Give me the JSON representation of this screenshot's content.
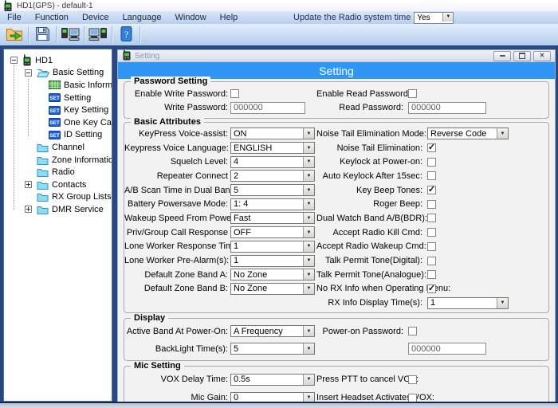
{
  "window": {
    "title": "HD1(GPS)  -  default-1",
    "menu": [
      "File",
      "Function",
      "Device",
      "Language",
      "Window",
      "Help"
    ],
    "update_time_label": "Update the Radio system time",
    "update_time_value": "Yes",
    "toolbar": [
      {
        "name": "open-file-icon"
      },
      {
        "name": "save-file-icon"
      },
      {
        "name": "read-from-radio-icon"
      },
      {
        "name": "write-to-radio-icon"
      },
      {
        "name": "help-icon"
      }
    ]
  },
  "tree": {
    "items": [
      {
        "label": "HD1",
        "icon": "radio",
        "expander": "minus",
        "level": 0
      },
      {
        "label": "Basic Setting",
        "icon": "folder-open",
        "expander": "minus",
        "level": 1
      },
      {
        "label": "Basic Information",
        "icon": "table",
        "level": 2
      },
      {
        "label": "Setting",
        "icon": "set",
        "level": 2
      },
      {
        "label": "Key Setting",
        "icon": "set",
        "level": 2
      },
      {
        "label": "One Key Call",
        "icon": "set",
        "level": 2
      },
      {
        "label": "ID Setting",
        "icon": "set",
        "level": 2
      },
      {
        "label": "Channel",
        "icon": "folder",
        "level": 1
      },
      {
        "label": "Zone Information",
        "icon": "folder",
        "level": 1
      },
      {
        "label": "Radio",
        "icon": "folder",
        "level": 1
      },
      {
        "label": "Contacts",
        "icon": "folder",
        "expander": "plus",
        "level": 1
      },
      {
        "label": "RX Group Lists",
        "icon": "folder",
        "level": 1
      },
      {
        "label": "DMR Service",
        "icon": "folder",
        "expander": "plus",
        "level": 1
      }
    ]
  },
  "setting_window": {
    "titlebar": "Setting",
    "banner": "Setting",
    "window_buttons": [
      "minimize",
      "maximize",
      "close"
    ],
    "sections": {
      "password_setting": {
        "title": "Password Setting",
        "rows": [
          {
            "left": {
              "label": "Enable Write Password:",
              "type": "checkbox",
              "checked": false
            },
            "right": {
              "label": "Enable Read Password:",
              "type": "checkbox",
              "checked": false
            }
          },
          {
            "left": {
              "label": "Write Password:",
              "type": "input",
              "value": "000000"
            },
            "right": {
              "label": "Read Password:",
              "type": "input",
              "value": "000000"
            }
          }
        ]
      },
      "basic_attributes": {
        "title": "Basic Attributes",
        "rows": [
          {
            "left": {
              "label": "KeyPress Voice-assist:",
              "type": "dropdown",
              "value": "ON"
            },
            "right": {
              "label": "Noise Tail Elimination Mode:",
              "type": "dropdown",
              "value": "Reverse Code"
            }
          },
          {
            "left": {
              "label": "Keypress Voice Language:",
              "type": "dropdown",
              "value": "ENGLISH"
            },
            "right": {
              "label": "Noise Tail Elimination:",
              "type": "checkbox",
              "checked": true
            }
          },
          {
            "left": {
              "label": "Squelch Level:",
              "type": "dropdown",
              "value": "4"
            },
            "right": {
              "label": "Keylock at Power-on:",
              "type": "checkbox",
              "checked": false
            }
          },
          {
            "left": {
              "label": "Repeater Connect",
              "type": "dropdown",
              "value": "2"
            },
            "right": {
              "label": "Auto Keylock After 15sec:",
              "type": "checkbox",
              "checked": false
            }
          },
          {
            "left": {
              "label": "A/B Scan Time in Dual Band(s):",
              "type": "dropdown",
              "value": "5"
            },
            "right": {
              "label": "Key Beep Tones:",
              "type": "checkbox",
              "checked": true
            }
          },
          {
            "left": {
              "label": "Battery Powersave Mode:",
              "type": "dropdown",
              "value": "1:  4"
            },
            "right": {
              "label": "Roger Beep:",
              "type": "checkbox",
              "checked": false
            }
          },
          {
            "left": {
              "label": "Wakeup Speed From Powersave:",
              "type": "dropdown",
              "value": "Fast"
            },
            "right": {
              "label": "Dual Watch Band A/B(BDR):",
              "type": "checkbox",
              "checked": false
            }
          },
          {
            "left": {
              "label": "Priv/Group Call Response",
              "type": "dropdown",
              "value": "OFF"
            },
            "right": {
              "label": "Accept Radio Kill Cmd:",
              "type": "checkbox",
              "checked": false
            }
          },
          {
            "left": {
              "label": "Lone Worker Response Time(m):",
              "type": "dropdown",
              "value": "1"
            },
            "right": {
              "label": "Accept Radio Wakeup Cmd:",
              "type": "checkbox",
              "checked": false
            }
          },
          {
            "left": {
              "label": "Lone Worker Pre-Alarm(s):",
              "type": "dropdown",
              "value": "1"
            },
            "right": {
              "label": "Talk Permit Tone(Digital):",
              "type": "checkbox",
              "checked": false
            }
          },
          {
            "left": {
              "label": "Default Zone Band A:",
              "type": "dropdown",
              "value": "No Zone"
            },
            "right": {
              "label": "Talk Permit Tone(Analogue):",
              "type": "checkbox",
              "checked": false
            }
          },
          {
            "left": {
              "label": "Default Zone Band B:",
              "type": "dropdown",
              "value": "No Zone"
            },
            "right": {
              "label": "No RX Info when Operating Menu:",
              "type": "checkbox",
              "checked": true
            }
          },
          {
            "left": null,
            "right": {
              "label": "RX Info Display Time(s):",
              "type": "dropdown",
              "value": "1"
            }
          }
        ]
      },
      "display": {
        "title": "Display",
        "rows": [
          {
            "left": {
              "label": "Active Band At Power-On:",
              "type": "dropdown",
              "value": "A Frequency"
            },
            "right": {
              "label": "Power-on Password:",
              "type": "checkbox",
              "checked": false
            }
          },
          {
            "left": {
              "label": "BackLight Time(s):",
              "type": "dropdown",
              "value": "5"
            },
            "right": {
              "label": "",
              "type": "input",
              "value": "000000",
              "name": "power-on-password-input"
            }
          }
        ]
      },
      "mic_setting": {
        "title": "Mic Setting",
        "rows": [
          {
            "left": {
              "label": "VOX Delay Time:",
              "type": "dropdown",
              "value": "0.5s"
            },
            "right": {
              "label": "Press PTT to cancel VOX:",
              "type": "checkbox",
              "checked": false
            }
          },
          {
            "left": {
              "label": "Mic Gain:",
              "type": "dropdown",
              "value": "0"
            },
            "right": {
              "label": "Insert Headset Activates VOX:",
              "type": "checkbox",
              "checked": false
            }
          }
        ]
      }
    }
  },
  "colors": {
    "banner_blue": "#2f96f6",
    "mdi_background": "#29487f",
    "menubar_blue": "#b7cfee",
    "panel_white": "#ffffff",
    "body_gray": "#f2f2f2"
  }
}
